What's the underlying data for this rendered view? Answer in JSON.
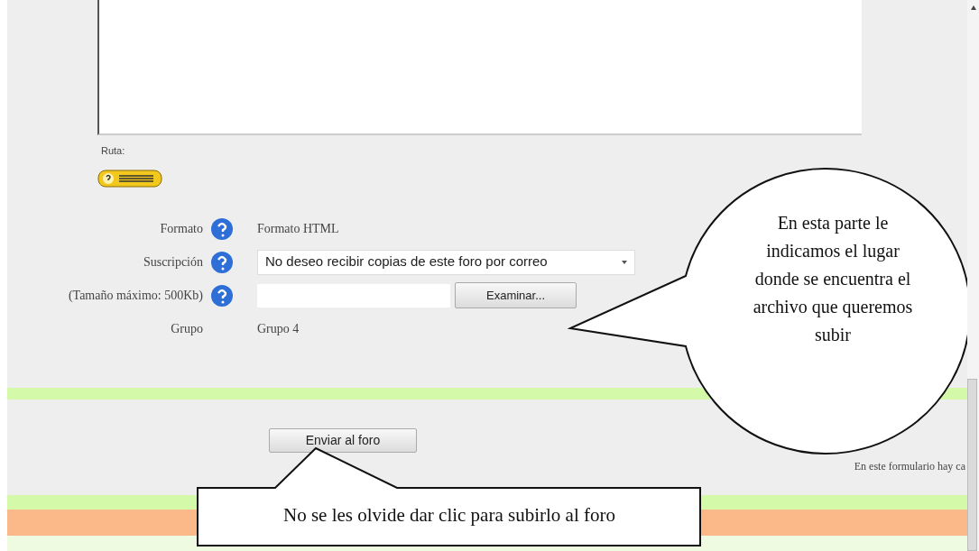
{
  "editor": {
    "path_label": "Ruta:"
  },
  "form": {
    "rows": [
      {
        "label": "Formato",
        "help": true,
        "kind": "text",
        "value": "Formato HTML"
      },
      {
        "label": "Suscripción",
        "help": true,
        "kind": "select",
        "value": "No deseo recibir copias de este foro por correo"
      },
      {
        "label": "(Tamaño máximo: 500Kb)",
        "help": true,
        "kind": "file",
        "button": "Examinar..."
      },
      {
        "label": "Grupo",
        "help": false,
        "kind": "text",
        "value": "Grupo 4"
      }
    ]
  },
  "submit_button": "Enviar al foro",
  "note": "En este formulario hay ca",
  "callouts": [
    {
      "kind": "bubble",
      "text": "En esta parte le indicamos el lugar donde se encuentra el archivo que queremos subir"
    },
    {
      "kind": "box",
      "text": "No se les olvide dar clic para subirlo al foro"
    }
  ]
}
